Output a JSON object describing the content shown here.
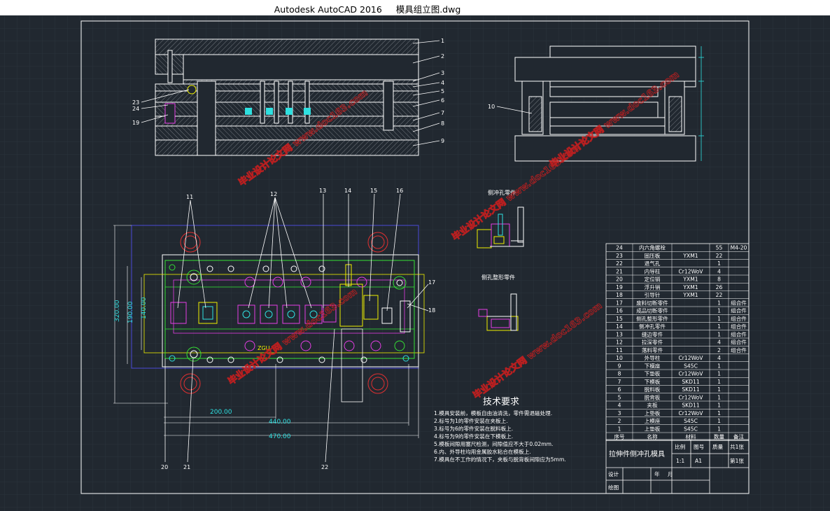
{
  "window": {
    "app_title": "Autodesk AutoCAD 2016",
    "file_name": "模具组立图.dwg"
  },
  "colors": {
    "background": "#212830",
    "frame": "#ffffff",
    "outline": "#ffffff",
    "magenta": "#e53ee5",
    "green": "#35e035",
    "yellow": "#f0f000",
    "cyan": "#2fe0e0",
    "red": "#e03030",
    "blue": "#4a4ad8",
    "watermark": "#d41e1e"
  },
  "section_view": {
    "part_numbers": [
      "1",
      "2",
      "3",
      "4",
      "5",
      "6",
      "7",
      "8",
      "9"
    ],
    "left_callouts": [
      "23",
      "24",
      "19"
    ]
  },
  "side_view": {
    "callout": "10"
  },
  "plan_view": {
    "top_callouts": [
      "11",
      "12",
      "13",
      "14",
      "15",
      "16"
    ],
    "right_callouts": [
      "17",
      "18"
    ],
    "bottom_callouts": [
      "20",
      "21",
      "22"
    ],
    "dimensions": {
      "d200": "200.00",
      "d440": "440.00",
      "d470": "470.00",
      "d320": "320.00",
      "d190": "190.00",
      "d140": "140.00"
    },
    "center_label": "ZGU"
  },
  "detail_labels": {
    "upper": "侧冲孔零件",
    "lower": "侧孔整形零件"
  },
  "tech_requirements": {
    "title": "技术要求",
    "items": [
      "1.模具安装前，模板自由油清洗，零件需退磁处理.",
      "2.标号为1的零件安装在夹板上.",
      "3.标号为6的零件安装在脱料板上.",
      "4.标号为9的零件安装在下模板上.",
      "5.模板间隙用塞尺检测，间隙值应不大于0.02mm.",
      "6.内、外导柱均用金属胶水粘合在模板上.",
      "7.模具在不工作的情况下，夹板与脱背板间隙应为5mm."
    ]
  },
  "bom": {
    "rows": [
      [
        "24",
        "内六角螺栓",
        "",
        "55",
        "M4-20"
      ],
      [
        "23",
        "固压板",
        "YXM1",
        "22",
        ""
      ],
      [
        "22",
        "退气孔",
        "",
        "1",
        ""
      ],
      [
        "21",
        "内导柱",
        "Cr12WoV",
        "4",
        ""
      ],
      [
        "20",
        "定位销",
        "YXM1",
        "8",
        ""
      ],
      [
        "19",
        "浮升销",
        "YXM1",
        "26",
        ""
      ],
      [
        "18",
        "引导针",
        "YXM1",
        "22",
        ""
      ],
      [
        "17",
        "废料切断零件",
        "",
        "1",
        "组合件"
      ],
      [
        "16",
        "成品切断零件",
        "",
        "1",
        "组合件"
      ],
      [
        "15",
        "侧孔整形零件",
        "",
        "1",
        "组合件"
      ],
      [
        "14",
        "侧冲孔零件",
        "",
        "1",
        "组合件"
      ],
      [
        "13",
        "缝边零件",
        "",
        "1",
        "组合件"
      ],
      [
        "12",
        "拉深零件",
        "",
        "4",
        "组合件"
      ],
      [
        "11",
        "落料零件",
        "",
        "2",
        "组合件"
      ],
      [
        "10",
        "外导柱",
        "Cr12WoV",
        "4",
        ""
      ],
      [
        "9",
        "下模座",
        "S45C",
        "1",
        ""
      ],
      [
        "8",
        "下垫板",
        "Cr12WoV",
        "1",
        ""
      ],
      [
        "7",
        "下模板",
        "SKD11",
        "1",
        ""
      ],
      [
        "6",
        "脱料板",
        "SKD11",
        "1",
        ""
      ],
      [
        "5",
        "脱背板",
        "Cr12WoV",
        "1",
        ""
      ],
      [
        "4",
        "夹板",
        "SKD11",
        "1",
        ""
      ],
      [
        "3",
        "上垫板",
        "Cr12WoV",
        "1",
        ""
      ],
      [
        "2",
        "上模座",
        "S45C",
        "1",
        ""
      ],
      [
        "1",
        "上垫板",
        "S45C",
        "1",
        ""
      ]
    ],
    "header": [
      "序号",
      "名称",
      "材料",
      "数量",
      "备注"
    ],
    "title": "拉伸件侧冲孔模具",
    "scale_label": "比例",
    "drawing_no_label": "图号",
    "weight_label": "质量",
    "sheets_total": "共1张",
    "scale_value": "1:1",
    "sheet_size": "A1",
    "sheet_no": "第1张",
    "designer_label": "设计",
    "drafter_label": "绘图",
    "year_label": "年",
    "month_label": "月"
  },
  "watermarks": [
    "毕业设计论文网 www.doc163.com",
    "毕业设计论文网 www.doc163.com",
    "毕业设计论文网 www.doc163.com",
    "毕业设计论文网 www.doc163.com",
    "毕业设计论文网 www.doc163.com"
  ]
}
